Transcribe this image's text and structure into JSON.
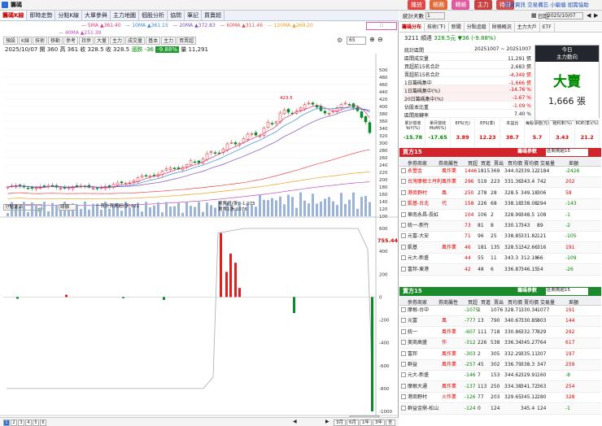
{
  "app": {
    "title": "籌碼",
    "top_buttons": [
      "播放",
      "帳務",
      "轉帳",
      "主力",
      "待辦"
    ],
    "top_links": [
      "期貨資訊",
      "交易備忘",
      "小編偏",
      "如需協助"
    ]
  },
  "tabs": [
    "籌碼K線",
    "即時走勢",
    "分點K線",
    "大單參與",
    "主力地圖",
    "個股分析",
    "協問",
    "筆記",
    "買賣超"
  ],
  "toolbar": {
    "items": [
      "預設",
      "K線",
      "技術",
      "移動",
      "參考",
      "持參",
      "大量",
      "主力",
      "成交量",
      "基本",
      "主力",
      "買賣超"
    ],
    "gear": "設定",
    "num_value": "65"
  },
  "legend": {
    "ma5": {
      "label": "5MA",
      "value": "361.40",
      "color": "#e0357a"
    },
    "ma10": {
      "label": "10MA",
      "value": "361.15",
      "color": "#3a86d6"
    },
    "ma20": {
      "label": "20MA",
      "value": "372.83",
      "color": "#7b4fb5"
    },
    "ma60": {
      "label": "60MA",
      "value": "311.46",
      "color": "#e84a4a"
    },
    "ma120": {
      "label": "120MA",
      "value": "269.20",
      "color": "#f0a020"
    },
    "ma240": {
      "label": "40MA",
      "value": "251.39",
      "color": "#c04cc0"
    }
  },
  "quote": {
    "date": "2025/10/07",
    "o_label": "開",
    "o": "360",
    "h_label": "高",
    "h": "361",
    "l_label": "收",
    "l": "328.5",
    "c_label": "收",
    "c": "328.5",
    "chg_label": "漲跌",
    "chg": "-36",
    "pct": "-9.88%",
    "vol_label": "量",
    "vol": "11,291"
  },
  "kchart": {
    "high_label": "423.5",
    "low_label": "175",
    "price_axis": [
      "500",
      "480",
      "460",
      "440",
      "420",
      "400",
      "380",
      "360",
      "340",
      "320",
      "300",
      "280",
      "260",
      "240",
      "220",
      "200",
      "180",
      "160",
      "140",
      "120",
      "100"
    ]
  },
  "subpanel": {
    "select_label": "分點進出",
    "button_label": "總額",
    "legend1": "一買計買賣超(張)321",
    "legend2": "賣賣超(張) -1,075",
    "legend3": "賣賣1張 1076",
    "current": "755.44",
    "axis": [
      "600",
      "400",
      "200",
      "0",
      "-200",
      "-400",
      "-600",
      "-800",
      "-1000"
    ]
  },
  "xaxis": {
    "labels": [
      "6/09",
      "7/01",
      "8/01",
      "9/01",
      "10/01"
    ],
    "year": "2025",
    "cursor": "2025/10/07"
  },
  "pager": {
    "pages": [
      "1",
      "2",
      "3",
      "4",
      "5",
      "6"
    ],
    "ranges": [
      "3月",
      "6月",
      "1年",
      "3年",
      "全"
    ]
  },
  "right": {
    "stat_label": "統計天數",
    "stat_value": "1",
    "date_label": "日期",
    "date_value": "2025/10/07",
    "tabs": [
      "籌碼分布",
      "技術(下)",
      "新聞",
      "分點追蹤",
      "財務概況",
      "主力大戶",
      "ETF"
    ],
    "stock": {
      "code": "3211",
      "name": "順達",
      "price": "328.5元",
      "chg": "▼36 (-9.88%)"
    },
    "summary_rows": [
      {
        "label": "統計區間",
        "value": "20251007 ~ 20251007"
      },
      {
        "label": "區間成交量",
        "value": "11,291 張"
      },
      {
        "label": "買超前15名合計",
        "value": "2,683 張"
      },
      {
        "label": "賣超前15名合計",
        "value": "-4,349 張"
      },
      {
        "label": "1日籌碼集中",
        "value": "-1,666 張"
      },
      {
        "label": "1日籌碼集中(%)",
        "value": "-14.76 %"
      },
      {
        "label": "20日籌碼集中(%)",
        "value": "-1.67 %"
      },
      {
        "label": "佔股本比重",
        "value": "-1.09 %"
      },
      {
        "label": "區間周轉率",
        "value": "7.40 %"
      }
    ],
    "today": {
      "title1": "今日",
      "title2": "主力動向",
      "action": "大賣",
      "amount": "1,666 張"
    },
    "fin_headers": [
      "累計營收YoY(%)",
      "單月營收MoM(%)",
      "EPS(元)",
      "EPS(季)",
      "本益比",
      "每股淨值(元)",
      "殖利率(%)",
      "ROE(季)(%)"
    ],
    "fin_values": [
      "-15.78",
      "-17.65",
      "3.89",
      "12.23",
      "38.7",
      "5.7",
      "3.43",
      "21.2"
    ],
    "buy": {
      "title": "買方15",
      "select_label": "籌碼參數",
      "select_value": "區間賣超15",
      "colhdr": [
        "參券商家",
        "券商屬性",
        "買超",
        "買進",
        "賣出",
        "買均價",
        "賣均價",
        "交易量",
        "差額"
      ],
      "rows": [
        {
          "name": "永豐金",
          "tag": "風作業",
          "v": [
            "1446",
            "1815",
            "369",
            "344.02",
            "339.12",
            "2184",
            "-2426"
          ]
        },
        {
          "name": "台灣摩根士丹利",
          "tag": "風作業",
          "v": [
            "296",
            "519",
            "223",
            "331.36",
            "343.4",
            "742",
            "202"
          ]
        },
        {
          "name": "港商野村",
          "tag": "風",
          "v": [
            "250",
            "278",
            "28",
            "328.5",
            "349.18",
            "306",
            "58"
          ]
        },
        {
          "name": "凱基-台北",
          "tag": "代",
          "v": [
            "158",
            "226",
            "68",
            "338.18",
            "338.08",
            "294",
            "-143"
          ]
        },
        {
          "name": "華南永昌-長虹",
          "tag": "",
          "v": [
            "104",
            "106",
            "2",
            "328.99",
            "348.5",
            "108",
            "-1"
          ]
        },
        {
          "name": "統一-新竹",
          "tag": "",
          "v": [
            "73",
            "81",
            "8",
            "330.17",
            "343",
            "89",
            "-2"
          ]
        },
        {
          "name": "元富-大安",
          "tag": "",
          "v": [
            "71",
            "96",
            "25",
            "338.85",
            "331.82",
            "121",
            "-105"
          ]
        },
        {
          "name": "凱基",
          "tag": "風作業",
          "v": [
            "46",
            "181",
            "135",
            "328.51",
            "342.66",
            "316",
            "191"
          ]
        },
        {
          "name": "元大-新盛",
          "tag": "",
          "v": [
            "44",
            "55",
            "11",
            "343.3",
            "312.18",
            "66",
            "-109"
          ]
        },
        {
          "name": "富邦-東港",
          "tag": "",
          "v": [
            "42",
            "48",
            "6",
            "336.87",
            "346.15",
            "54",
            "-26"
          ]
        }
      ]
    },
    "sell": {
      "title": "賣方15",
      "select_label": "籌碼參數",
      "select_value": "區間賣超15",
      "rows": [
        {
          "name": "摩根-台中",
          "tag": "",
          "v": [
            "-1075",
            "1",
            "1076",
            "328.71",
            "330.34",
            "1077",
            "191"
          ]
        },
        {
          "name": "元富",
          "tag": "風",
          "v": [
            "-777",
            "13",
            "790",
            "340.67",
            "330.85",
            "803",
            "144"
          ]
        },
        {
          "name": "統一",
          "tag": "風作業",
          "v": [
            "-607",
            "111",
            "718",
            "330.86",
            "332.77",
            "829",
            "292"
          ]
        },
        {
          "name": "美商高盛",
          "tag": "作",
          "v": [
            "-312",
            "226",
            "538",
            "336.34",
            "345.27",
            "764",
            "617"
          ]
        },
        {
          "name": "富邦",
          "tag": "風作業",
          "v": [
            "-303",
            "2",
            "305",
            "332.29",
            "335.11",
            "307",
            "197"
          ]
        },
        {
          "name": "群益",
          "tag": "風作業",
          "v": [
            "-257",
            "45",
            "302",
            "336.79",
            "338.3",
            "347",
            "259"
          ]
        },
        {
          "name": "元大-新盛",
          "tag": "",
          "v": [
            "-146",
            "7",
            "153",
            "344.62",
            "329.91",
            "160",
            "-8"
          ]
        },
        {
          "name": "摩根大通",
          "tag": "風作業",
          "v": [
            "-137",
            "113",
            "250",
            "334.38",
            "341.72",
            "363",
            "254"
          ]
        },
        {
          "name": "港商野村",
          "tag": "火作業",
          "v": [
            "-126",
            "77",
            "203",
            "329.65",
            "345.12",
            "280",
            "328"
          ]
        },
        {
          "name": "群益金鼎-松山",
          "tag": "",
          "v": [
            "-124",
            "0",
            "124",
            "",
            "345.4",
            "124",
            "-1"
          ]
        }
      ]
    }
  }
}
